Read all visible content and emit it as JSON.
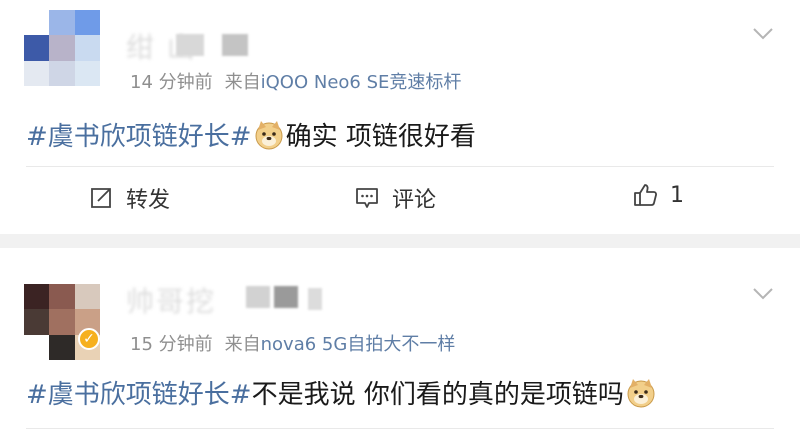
{
  "posts": [
    {
      "username": "绀  山",
      "time": "14 分钟前",
      "source_prefix": "来自",
      "source": "iQOO Neo6 SE竞速标杆",
      "hashtag": "#虞书欣项链好长#",
      "text": "确实 项链很好看",
      "actions": {
        "repost": "转发",
        "comment": "评论",
        "like_count": "1"
      }
    },
    {
      "username": "帅哥挖",
      "time": "15 分钟前",
      "source_prefix": "来自",
      "source": "nova6 5G自拍大不一样",
      "hashtag": "#虞书欣项链好长#",
      "text": "不是我说 你们看的真的是项链吗"
    }
  ],
  "colors": {
    "hashtag": "#4a6f9f",
    "source": "#5f7ea6",
    "meta": "#8f8f8f",
    "verified_badge": "#f6b01e"
  },
  "icons": [
    "chevron-down-icon",
    "repost-icon",
    "comment-icon",
    "like-icon",
    "doge-emoji-icon",
    "verified-badge-icon"
  ]
}
